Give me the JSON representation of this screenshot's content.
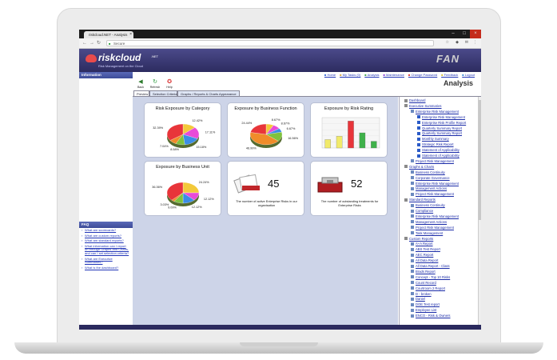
{
  "browser": {
    "tab_title": "riskcloud.NET - Analysis",
    "url": "Secure"
  },
  "header": {
    "logo": "riskcloud",
    "logo_net": ".NET",
    "tagline": "Risk Management on the Cloud",
    "partner_logo": "FAN"
  },
  "top_links": [
    "Home",
    "My Tasks (0)",
    "Analysis",
    "Maintenance",
    "Change Password",
    "Feedback",
    "Logout"
  ],
  "page_title": "Analysis",
  "toolbar": [
    {
      "label": "Back",
      "icon": "back-arrow-icon"
    },
    {
      "label": "Refresh",
      "icon": "refresh-icon"
    },
    {
      "label": "Help",
      "icon": "help-lifebuoy-icon"
    }
  ],
  "tabs": [
    "Preview",
    "Selection Criteria",
    "Graphs / Reports & Charts Appearance"
  ],
  "sidebar": {
    "info_title": "Information",
    "faq_title": "FAQ",
    "faq_links": [
      "What are scorecards?",
      "What are custom reports?",
      "What are standard reports?",
      "What information can I report on through Graphs and Charts, and can I set selection criteria?",
      "What are Executive Summaries?",
      "What is the dashboard?"
    ]
  },
  "tiles": {
    "risk_category": {
      "title": "Risk Exposure by Category",
      "labels": [
        "12.42%",
        "17.11%",
        "15.18%",
        "8.58%",
        "7.04%",
        "32.39%"
      ]
    },
    "business_function": {
      "title": "Exposure by Business Function",
      "labels": [
        "8.67%",
        "8.67%",
        "6.67%",
        "16.56%",
        "46.99%",
        "24.44%"
      ]
    },
    "risk_rating": {
      "title": "Exposure by Risk Rating"
    },
    "business_unit": {
      "title": "Exposure by Business Unit",
      "labels": [
        "24.24%",
        "12.12%",
        "12.12%",
        "9.09%",
        "3.03%",
        "36.36%"
      ]
    },
    "active_risks": {
      "value": "45",
      "caption": "The number of active Enterprise Risks in our organisation"
    },
    "outstanding_treatments": {
      "value": "52",
      "caption": "The number of outstanding treatments for Enterprise Risks"
    }
  },
  "chart_data": [
    {
      "type": "pie",
      "title": "Risk Exposure by Category",
      "categories": [
        "",
        "",
        "",
        "",
        "",
        ""
      ],
      "values": [
        12.42,
        17.11,
        15.18,
        8.58,
        7.04,
        32.39
      ]
    },
    {
      "type": "pie",
      "title": "Exposure by Business Function",
      "categories": [
        "",
        "",
        "",
        "",
        "",
        ""
      ],
      "values": [
        8.67,
        8.67,
        6.67,
        16.56,
        46.99,
        24.44
      ]
    },
    {
      "type": "bar",
      "title": "Exposure by Risk Rating",
      "categories": [
        "",
        "",
        "",
        "",
        ""
      ],
      "values": [
        5,
        7,
        16,
        9,
        4
      ]
    },
    {
      "type": "pie",
      "title": "Exposure by Business Unit",
      "categories": [
        "",
        "",
        "",
        "",
        "",
        ""
      ],
      "values": [
        24.24,
        12.12,
        12.12,
        9.09,
        3.03,
        36.36
      ]
    }
  ],
  "colors": {
    "pie": [
      "#f3c93a",
      "#e84bd8",
      "#3b8de6",
      "#7fc23e",
      "#f08c2a",
      "#e8353a"
    ],
    "bars": [
      "#f1ea6a",
      "#f1ea6a",
      "#e8353a",
      "#3fb14a",
      "#3fb14a"
    ]
  },
  "tree": [
    {
      "label": "Dashboard",
      "level": 0
    },
    {
      "label": "Executive Summaries",
      "level": 0
    },
    {
      "label": "Enterprise Risk Management",
      "level": 1
    },
    {
      "label": "Enterprise Risk Management",
      "level": 2
    },
    {
      "label": "Enterprise Risk Profile Report",
      "level": 2
    },
    {
      "label": "Quarterly Summary Report",
      "level": 2
    },
    {
      "label": "Quarterly Summary Report",
      "level": 2
    },
    {
      "label": "Monthly Summary",
      "level": 2
    },
    {
      "label": "Strategic Risk Report",
      "level": 2
    },
    {
      "label": "Statement of Applicability",
      "level": 2
    },
    {
      "label": "Statement of Applicability",
      "level": 2
    },
    {
      "label": "Project Risk Management",
      "level": 1
    },
    {
      "label": "Graphs & Charts",
      "level": 0
    },
    {
      "label": "Business Continuity",
      "level": 1
    },
    {
      "label": "Corporate Governance",
      "level": 1
    },
    {
      "label": "Enterprise Risk Management",
      "level": 1
    },
    {
      "label": "Management Actions",
      "level": 1
    },
    {
      "label": "Project Risk Management",
      "level": 1
    },
    {
      "label": "Standard Reports",
      "level": 0
    },
    {
      "label": "Business Continuity",
      "level": 1
    },
    {
      "label": "Compliance",
      "level": 1
    },
    {
      "label": "Enterprise Risk Management",
      "level": 1
    },
    {
      "label": "Management Actions",
      "level": 1
    },
    {
      "label": "Project Risk Management",
      "level": 1
    },
    {
      "label": "Task Management",
      "level": 1
    },
    {
      "label": "Custom Reports",
      "level": 0
    },
    {
      "label": "A+A Report",
      "level": 1
    },
    {
      "label": "ABS Test Report",
      "level": 1
    },
    {
      "label": "AEC Report",
      "level": 1
    },
    {
      "label": "All Data Report",
      "level": 1
    },
    {
      "label": "All Data Report - Class",
      "level": 1
    },
    {
      "label": "Brads Report",
      "level": 1
    },
    {
      "label": "Concept - Top 10 Risks",
      "level": 1
    },
    {
      "label": "Count Record",
      "level": 1
    },
    {
      "label": "Courtroom 2 Report",
      "level": 1
    },
    {
      "label": "D - broken",
      "level": 1
    },
    {
      "label": "Daniel",
      "level": 1
    },
    {
      "label": "DOE Test report",
      "level": 1
    },
    {
      "label": "Employee List",
      "level": 1
    },
    {
      "label": "ENCO - Risk & Owners",
      "level": 1
    }
  ]
}
